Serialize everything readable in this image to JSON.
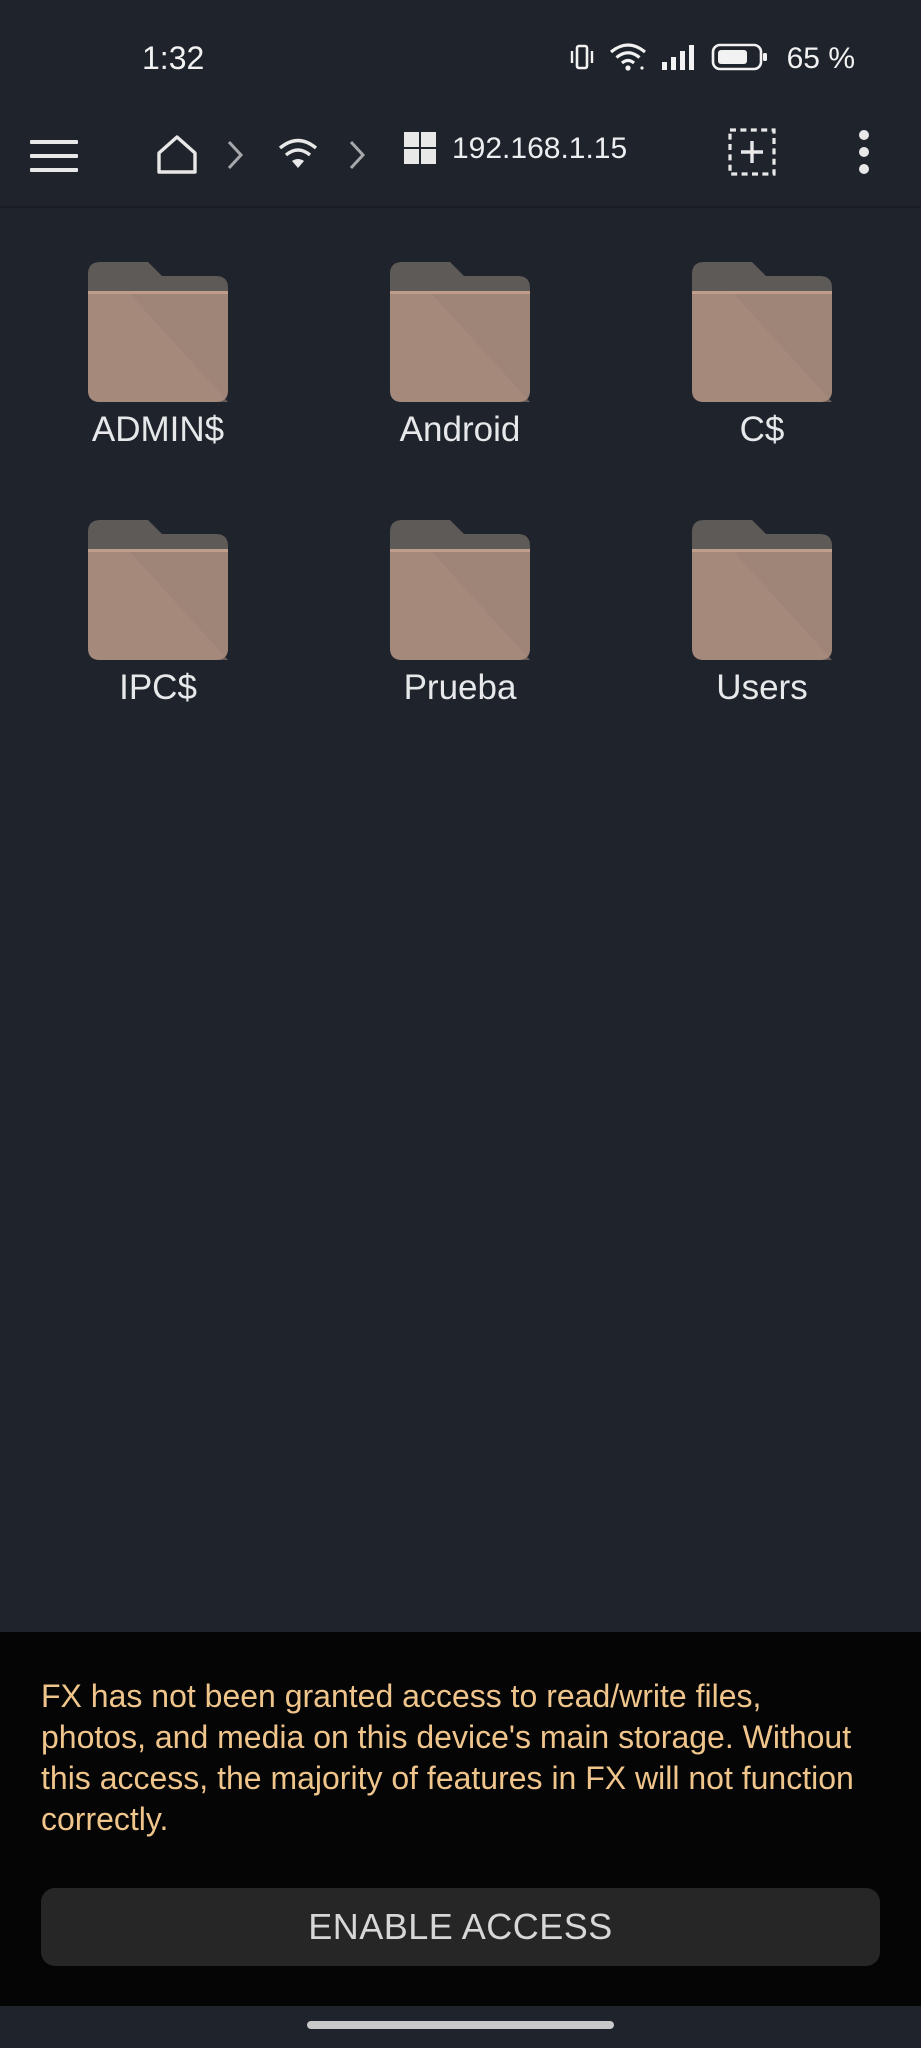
{
  "status_bar": {
    "time": "1:32",
    "battery_percent": "65 %",
    "icons": [
      "vibrate-icon",
      "wifi-icon",
      "signal-icon",
      "battery-icon"
    ]
  },
  "toolbar": {
    "host": "192.168.1.15",
    "icons": [
      "menu-icon",
      "home-icon",
      "chevron-right-icon",
      "wifi-icon",
      "chevron-right-icon",
      "windows-icon",
      "add-selection-icon",
      "more-vert-icon"
    ]
  },
  "folders": [
    {
      "name": "ADMIN$"
    },
    {
      "name": "Android"
    },
    {
      "name": "C$"
    },
    {
      "name": "IPC$"
    },
    {
      "name": "Prueba"
    },
    {
      "name": "Users"
    }
  ],
  "banner": {
    "message": "FX has not been granted access to read/write files, photos, and media on this device's main storage. Without this access, the majority of features in FX will not function correctly.",
    "button_label": "ENABLE ACCESS"
  },
  "colors": {
    "background": "#1f232b",
    "folder": "#a58a7c",
    "folder_tab": "#5e5a58",
    "banner_text": "#f0c58c",
    "banner_bg": "#050505"
  }
}
